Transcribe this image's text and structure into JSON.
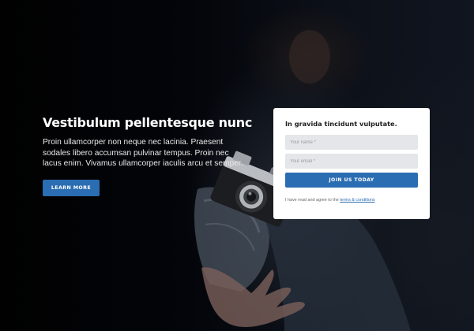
{
  "hero": {
    "title": "Vestibulum pellentesque nunc",
    "body": "Proin ullamcorper non neque nec lacinia. Praesent sodales libero accumsan pulvinar tempus. Proin nec lacus enim. Vivamus ullamcorper iaculis arcu et semper.",
    "cta_label": "LEARN MORE"
  },
  "signup_form": {
    "title": "In gravida tincidunt vulputate.",
    "name_placeholder": "Your name *",
    "email_placeholder": "Your email *",
    "submit_label": "JOIN US TODAY",
    "consent_prefix": "I have read and agree to the",
    "terms_link": "terms & conditions"
  },
  "colors": {
    "accent": "#2a6db2",
    "card_background": "#ffffff",
    "field_background": "#e4e6e9",
    "page_background": "#000000"
  },
  "icons": {
    "background_image": "camera-photo"
  }
}
